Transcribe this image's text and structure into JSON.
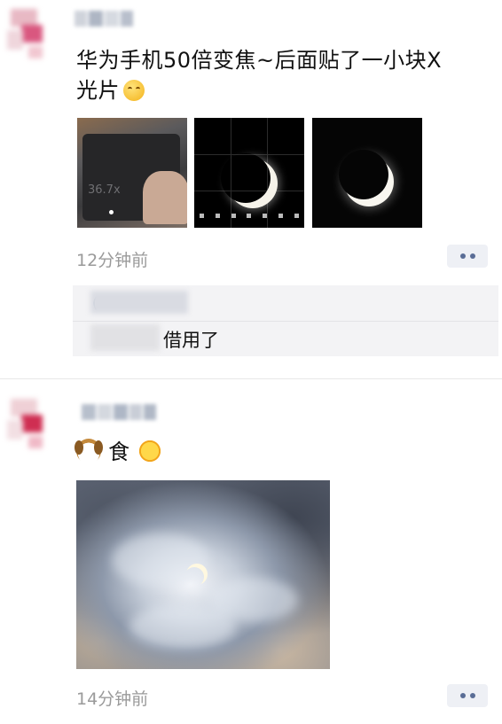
{
  "posts": [
    {
      "text_line1": "华为手机50倍变焦~后面贴了一小块X",
      "text_line2": "光片",
      "thumbs": [
        {
          "kind": "phone-photo",
          "zoom_text": "36.7x"
        },
        {
          "kind": "camera-preview-crescent"
        },
        {
          "kind": "crescent-photo"
        }
      ],
      "time": "12分钟前",
      "comment": {
        "text": "借用了"
      }
    },
    {
      "text_word": "食",
      "emoji_before": "dog-face-emoji",
      "emoji_after": "sun-face-emoji",
      "time": "14分钟前"
    }
  ],
  "icons": {
    "smile": "smiling-face-emoji",
    "more": "more-dots-icon",
    "comment": "comment-icon"
  },
  "colors": {
    "link": "#5a6d96",
    "time": "#9a9a9a",
    "comment_bg": "#f3f3f5"
  }
}
